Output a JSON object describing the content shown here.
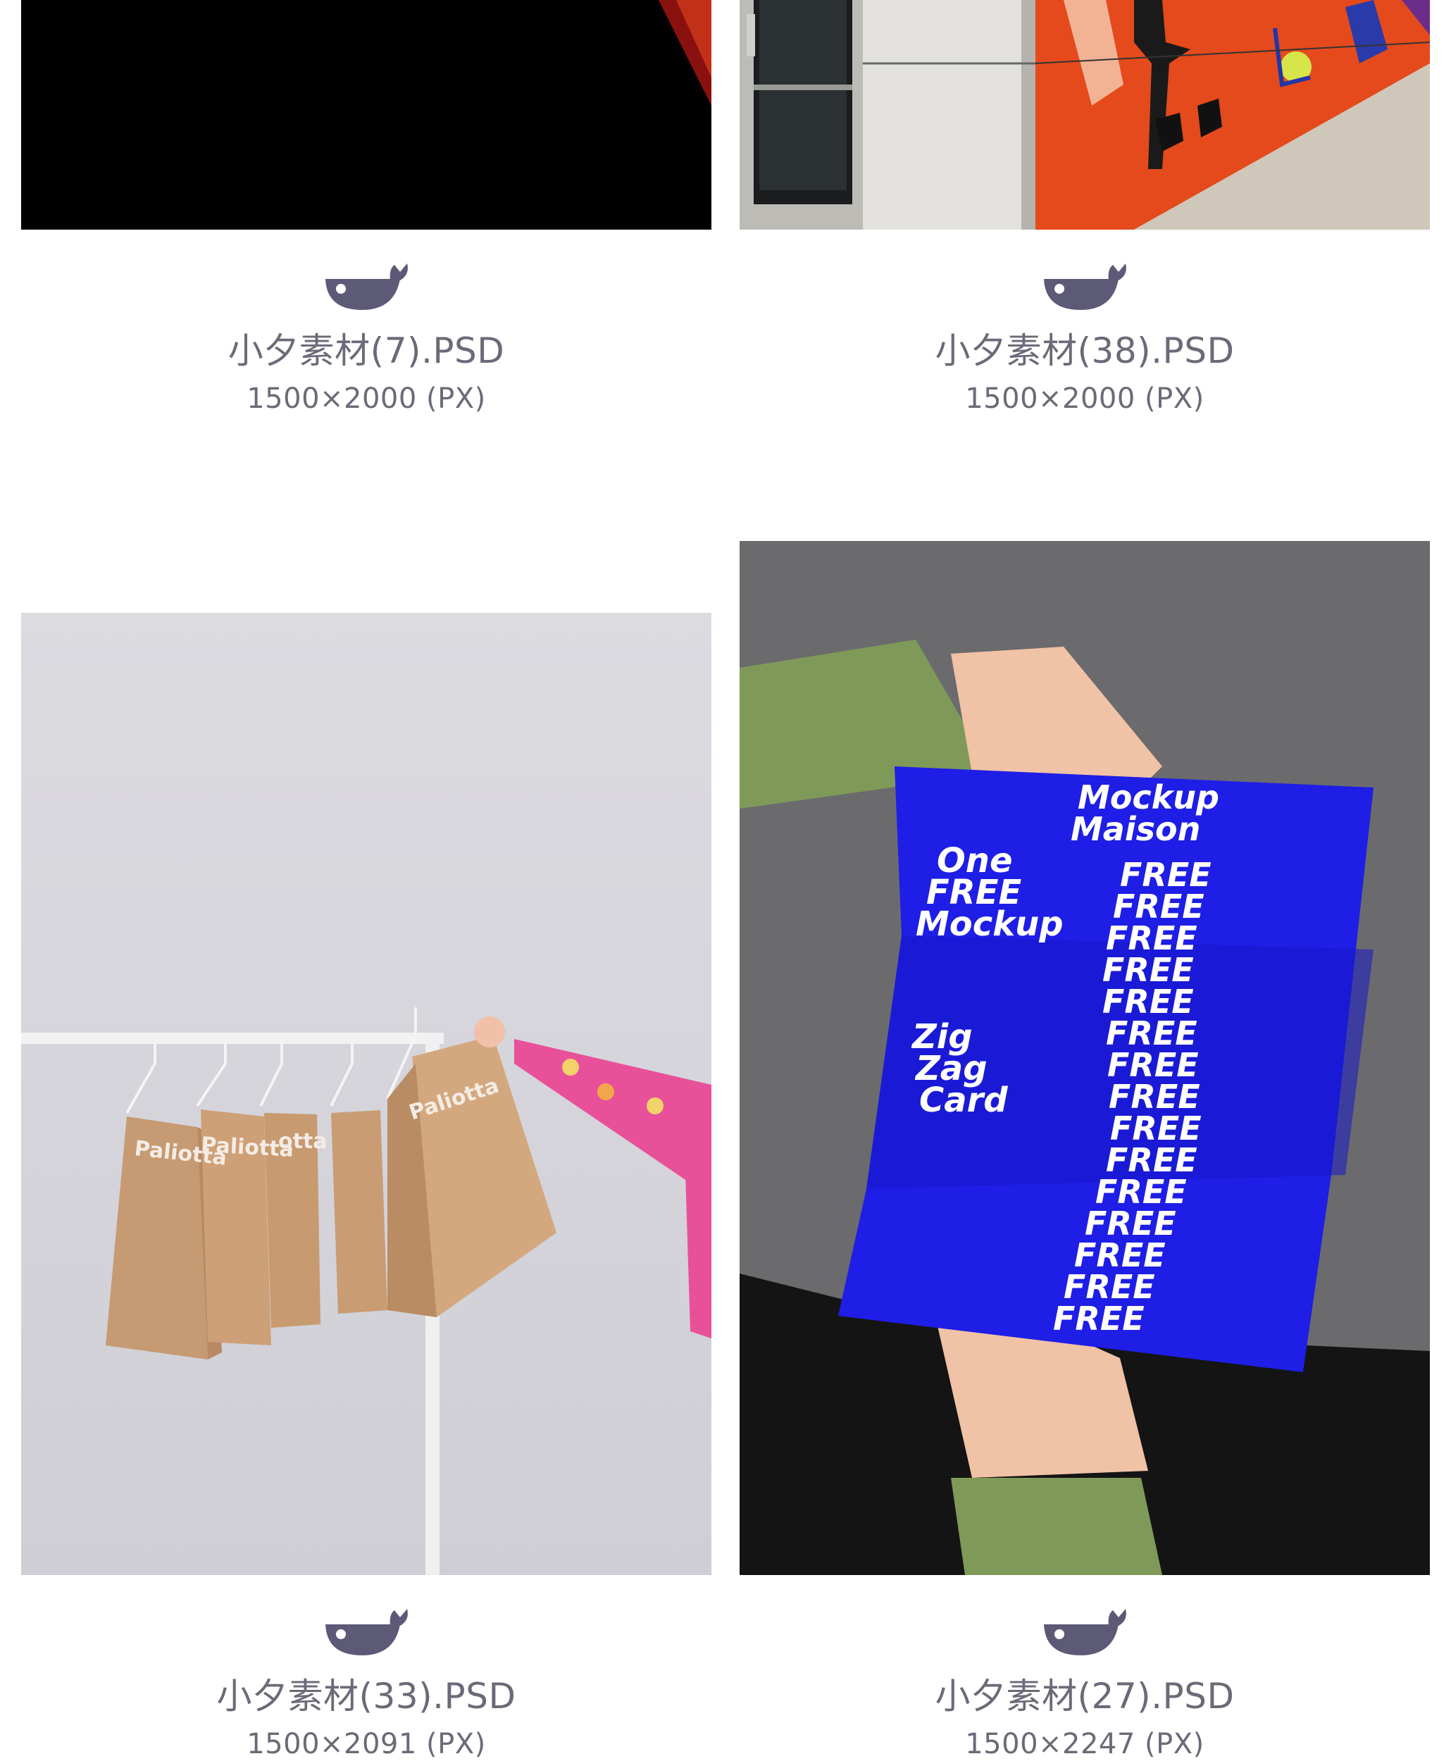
{
  "cards": [
    {
      "filename": "小夕素材(7).PSD",
      "dimensions": "1500×2000 (PX)"
    },
    {
      "filename": "小夕素材(38).PSD",
      "dimensions": "1500×2000 (PX)"
    },
    {
      "filename": "小夕素材(33).PSD",
      "dimensions": "1500×2091 (PX)",
      "image_text": [
        "Paliotta",
        "Paliotta",
        "otta",
        "Paliotta"
      ]
    },
    {
      "filename": "小夕素材(27).PSD",
      "dimensions": "1500×2247 (PX)",
      "image_text": {
        "brand": [
          "Mockup",
          "Maison"
        ],
        "headline": [
          "One",
          "FREE",
          "Mockup"
        ],
        "side": [
          "Zig",
          "Zag",
          "Card"
        ],
        "repeat": "FREE"
      }
    }
  ],
  "logo_icon": "whale-logo-icon",
  "colors": {
    "text": "#6a6a78",
    "logo": "#5d5a78",
    "card_blue": "#1e1ee6",
    "background": "#ffffff"
  }
}
